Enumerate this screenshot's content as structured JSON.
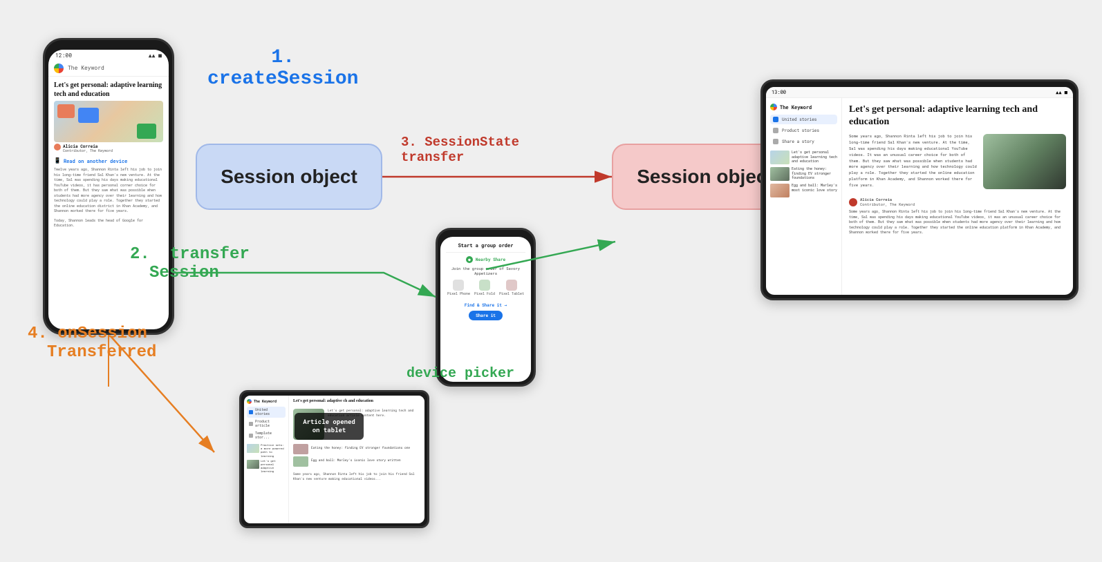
{
  "step1": {
    "number": "1.",
    "label": "createSession"
  },
  "step2": {
    "number": "2.",
    "label1": "transfer",
    "label2": "Session"
  },
  "step3": {
    "number": "3.",
    "label1": "SessionState",
    "label2": "transfer"
  },
  "step4": {
    "number": "4.",
    "label1": "onSession",
    "label2": "Transferred"
  },
  "sessionBoxLeft": {
    "text": "Session object"
  },
  "sessionBoxRight": {
    "text": "Session object"
  },
  "devicePickerLabel": "device picker",
  "articleTitle": "Let's get personal: adaptive learning tech and education",
  "articleTitleTablet": "Let's get personal: adaptive learning tech and education",
  "articleOverlay": "Article opened on tablet",
  "phoneLeft": {
    "statusTime": "12:00",
    "googleBarText": "The Keyword",
    "articleTitle": "Let's get personal: adaptive learning tech and education",
    "readLink": "Read on another device",
    "authorName": "Alicia Correia",
    "authorRole": "Contributor, The Keyword",
    "bodyText1": "Twelve years ago, Shannon Rinta left his job to join his long-time friend Sal Khan's new venture. At the time, Sal was spending his days making educational YouTube videos, it has personal corner choice for both of them. But they saw what was possible when students had more agency over their learning and how technology could play a role. Together they started the online education district in Khan Academy, and Shannon worked there for five years.",
    "bodyText2": "Today, Shannon leads the head of Google for Education."
  },
  "tabletRight": {
    "statusTime": "13:00",
    "logoText": "The Keyword",
    "sidebarItems": [
      "United stories",
      "Product stories",
      "Share a story"
    ],
    "articleTitle": "Let's get personal: adaptive learning tech and education"
  },
  "tabletBottom": {
    "logoText": "The Keyword",
    "sidebarItems": [
      "United stories",
      "Product article",
      "Template stor..."
    ],
    "articleTitle": "Let's get personal: adaptive ch and education",
    "overlayText": "Article opened on tablet"
  }
}
